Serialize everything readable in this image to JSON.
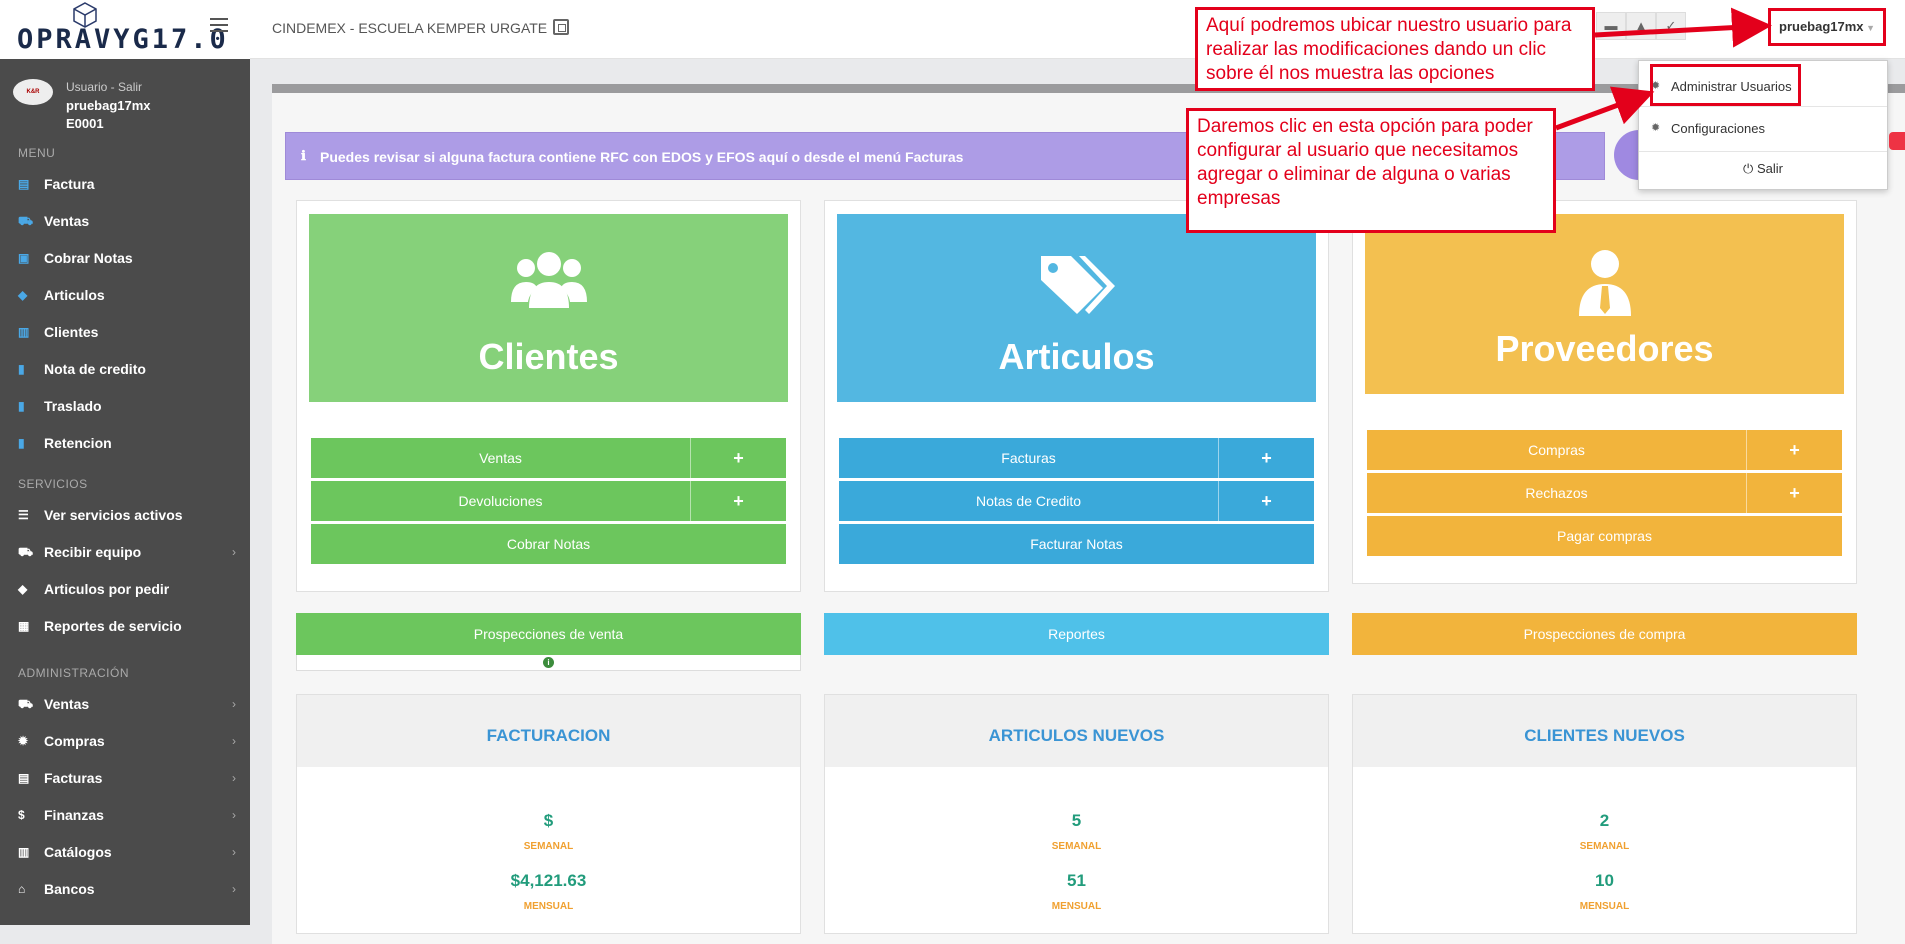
{
  "header": {
    "logo_text": "OPRAVYG17.0",
    "company": "CINDEMEX - ESCUELA KEMPER URGATE",
    "username": "pruebag17mx"
  },
  "sidebar": {
    "user": {
      "avatar_text": "K&R",
      "salir": "Usuario - Salir",
      "name": "pruebag17mx",
      "id": "E0001"
    },
    "section_menu": "MENU",
    "section_servicios": "SERVICIOS",
    "section_admin": "ADMINISTRACIÓN",
    "menu": [
      "Factura",
      "Ventas",
      "Cobrar Notas",
      "Articulos",
      "Clientes",
      "Nota de credito",
      "Traslado",
      "Retencion"
    ],
    "servicios": [
      "Ver servicios activos",
      "Recibir equipo",
      "Articulos por pedir",
      "Reportes de servicio"
    ],
    "admin": [
      "Ventas",
      "Compras",
      "Facturas",
      "Finanzas",
      "Catálogos",
      "Bancos"
    ]
  },
  "alert": "Puedes revisar si alguna factura contiene RFC con EDOS y EFOS aquí o desde el menú Facturas",
  "cards": {
    "clientes": {
      "title": "Clientes",
      "btn1": "Ventas",
      "btn2": "Devoluciones",
      "btn3": "Cobrar Notas",
      "plus": "+"
    },
    "articulos": {
      "title": "Articulos",
      "btn1": "Facturas",
      "btn2": "Notas de Credito",
      "btn3": "Facturar Notas",
      "plus": "+"
    },
    "proveedores": {
      "title": "Proveedores",
      "btn1": "Compras",
      "btn2": "Rechazos",
      "btn3": "Pagar compras",
      "plus": "+"
    }
  },
  "wide": {
    "venta": "Prospecciones de venta",
    "reportes": "Reportes",
    "compra": "Prospecciones de compra"
  },
  "stats": {
    "facturacion": {
      "title": "FACTURACION",
      "v1": "$",
      "l1": "SEMANAL",
      "v2": "$4,121.63",
      "l2": "MENSUAL"
    },
    "articulos": {
      "title": "ARTICULOS NUEVOS",
      "v1": "5",
      "l1": "SEMANAL",
      "v2": "51",
      "l2": "MENSUAL"
    },
    "clientes": {
      "title": "CLIENTES NUEVOS",
      "v1": "2",
      "l1": "SEMANAL",
      "v2": "10",
      "l2": "MENSUAL"
    }
  },
  "dropdown": {
    "item1": "Administrar Usuarios",
    "item2": "Configuraciones",
    "item3": "Salir"
  },
  "annotations": {
    "a1": "Aquí podremos ubicar nuestro usuario para realizar las modificaciones dando un clic sobre él nos muestra las opciones",
    "a2": "Daremos clic en esta opción para poder configurar al usuario que necesitamos agregar o eliminar de alguna o varias empresas"
  },
  "colors": {
    "green": "#6cc65d",
    "blue": "#3aa9da",
    "orange": "#f2b43c",
    "red": "#e3001b"
  }
}
